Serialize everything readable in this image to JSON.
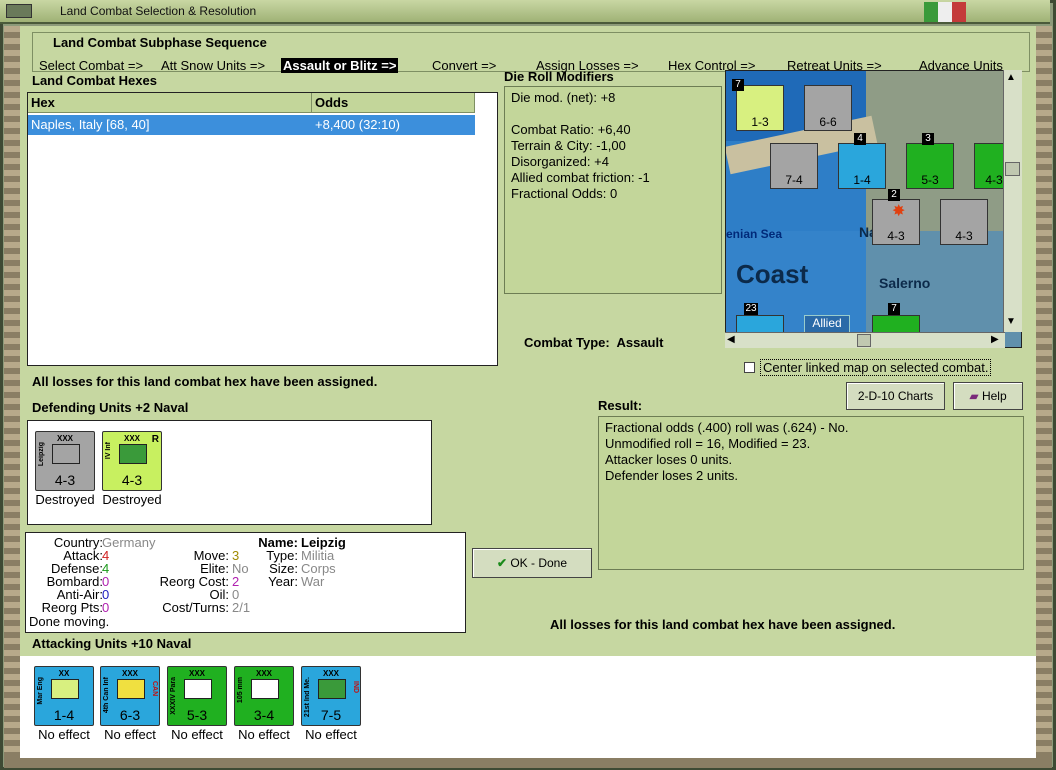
{
  "window": {
    "title": "Land Combat Selection & Resolution"
  },
  "sequence": {
    "title": "Land Combat Subphase Sequence",
    "items": [
      "Select Combat =>",
      "Att Snow Units =>",
      "Assault or Blitz =>",
      "Convert =>",
      "Assign Losses =>",
      "Hex Control =>",
      "Retreat Units =>",
      "Advance Units"
    ]
  },
  "hexes": {
    "title": "Land Combat Hexes",
    "headers": [
      "Hex",
      "Odds"
    ],
    "rows": [
      {
        "hex": "Naples, Italy [68, 40]",
        "odds": "+8,400 (32:10)"
      }
    ]
  },
  "modifiers": {
    "title": "Die Roll Modifiers",
    "lines": [
      "Die mod. (net): +8",
      "",
      "Combat Ratio: +6,40",
      "Terrain & City: -1,00",
      "Disorganized: +4",
      "Allied combat friction: -1",
      "Fractional Odds: 0"
    ]
  },
  "combat_type": {
    "label": "Combat Type:",
    "value": "Assault"
  },
  "center_map": {
    "label": "Center linked map on selected combat."
  },
  "losses_msg": "All losses for this land combat hex have been assigned.",
  "defending": {
    "title": "Defending Units +2 Naval",
    "units": [
      {
        "name": "Leipzig",
        "size": "XXX",
        "strength": "4-3",
        "status": "Destroyed",
        "color": "#a4a4a4",
        "badge": ""
      },
      {
        "name": "IV Inf",
        "size": "XXX",
        "strength": "4-3",
        "status": "Destroyed",
        "color": "#c8f060",
        "badge": "R"
      }
    ]
  },
  "buttons": {
    "charts": "2-D-10 Charts",
    "help": "Help",
    "ok": "OK - Done"
  },
  "result": {
    "title": "Result:",
    "lines": [
      "Fractional odds (.400) roll was (.624)  - No.",
      "Unmodified roll = 16, Modified = 23.",
      "Attacker loses 0 units.",
      "Defender loses 2 units."
    ]
  },
  "unit_info": {
    "country_label": "Country:",
    "country": "Germany",
    "attack_label": "Attack:",
    "attack": "4",
    "defense_label": "Defense:",
    "defense": "4",
    "bombard_label": "Bombard:",
    "bombard": "0",
    "antiair_label": "Anti-Air:",
    "antiair": "0",
    "reorgpts_label": "Reorg Pts:",
    "reorgpts": "0",
    "move_label": "Move:",
    "move": "3",
    "elite_label": "Elite:",
    "elite": "No",
    "reorgcost_label": "Reorg Cost:",
    "reorgcost": "2",
    "oil_label": "Oil:",
    "oil": "0",
    "costturns_label": "Cost/Turns:",
    "costturns": "2/1",
    "name_label": "Name:",
    "name": "Leipzig",
    "type_label": "Type:",
    "type": "Militia",
    "size_label": "Size:",
    "size": "Corps",
    "year_label": "Year:",
    "year": "War",
    "status": "Done moving."
  },
  "attacking": {
    "title": "Attacking Units +10 Naval",
    "units": [
      {
        "name": "Mar Eng",
        "size": "XX",
        "strength": "1-4",
        "status": "No effect",
        "color": "#2aa6dc",
        "badge": ""
      },
      {
        "name": "4th Can Inf",
        "size": "XXX",
        "strength": "6-3",
        "status": "No effect",
        "color": "#2aa6dc",
        "badge": "CAN"
      },
      {
        "name": "XXXIV Para",
        "size": "XXX",
        "strength": "5-3",
        "status": "No effect",
        "color": "#20b020",
        "badge": ""
      },
      {
        "name": "105 mm",
        "size": "XXX",
        "strength": "3-4",
        "status": "No effect",
        "color": "#20b020",
        "badge": ""
      },
      {
        "name": "21st Ind Me.",
        "size": "XXX",
        "strength": "7-5",
        "status": "No effect",
        "color": "#2aa6dc",
        "badge": "IND"
      }
    ]
  },
  "map": {
    "labels": {
      "sea": "enian Sea",
      "coast": "Coast",
      "naples": "Napl",
      "salerno": "Salerno",
      "allied": "Allied"
    },
    "counters": [
      {
        "strength": "1-3",
        "color": "#d8f080",
        "stack": "7"
      },
      {
        "strength": "6-6",
        "color": "#a4a4a4",
        "stack": ""
      },
      {
        "strength": "7-4",
        "color": "#a4a4a4",
        "stack": ""
      },
      {
        "strength": "1-4",
        "color": "#2aa6dc",
        "stack": "4"
      },
      {
        "strength": "5-3",
        "color": "#20b020",
        "stack": "3"
      },
      {
        "strength": "4-3",
        "color": "#20b020",
        "stack": ""
      },
      {
        "strength": "4-3",
        "color": "#a4a4a4",
        "stack": "2"
      },
      {
        "strength": "4-3",
        "color": "#a4a4a4",
        "stack": ""
      }
    ],
    "bottom_stacks": [
      "23",
      "7"
    ]
  }
}
